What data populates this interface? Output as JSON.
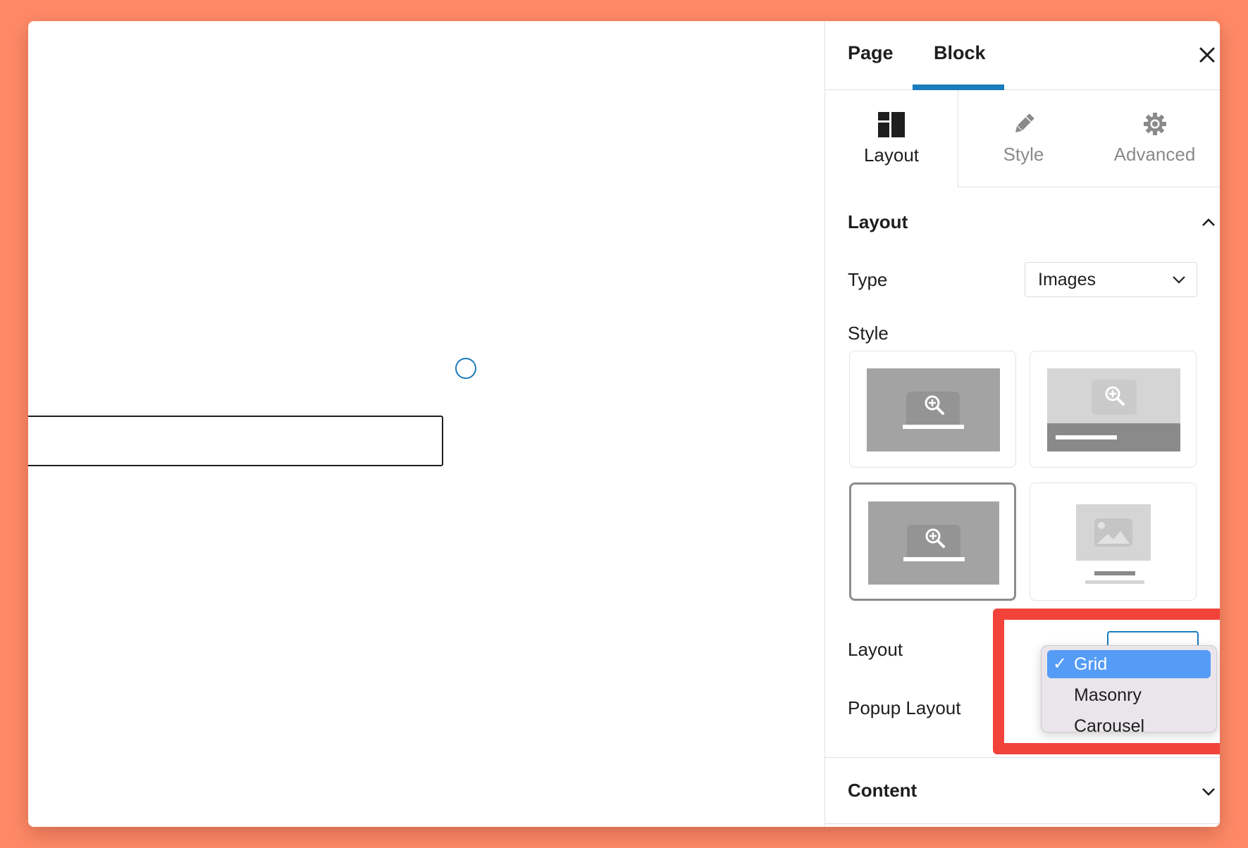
{
  "colors": {
    "background": "#FF8A68",
    "accent": "#1a7bbd",
    "highlight_box": "#f2433a",
    "selected_option": "#559cf7"
  },
  "header": {
    "tabs": [
      {
        "label": "Page",
        "active": false
      },
      {
        "label": "Block",
        "active": true
      }
    ],
    "close_icon": "close-icon"
  },
  "subtabs": [
    {
      "label": "Layout",
      "icon": "layout-icon",
      "active": true
    },
    {
      "label": "Style",
      "icon": "pencil-icon",
      "active": false
    },
    {
      "label": "Advanced",
      "icon": "gear-icon",
      "active": false
    }
  ],
  "sections": {
    "layout": {
      "title": "Layout",
      "expanded": true,
      "type_label": "Type",
      "type_value": "Images",
      "style_label": "Style",
      "style_options": [
        {
          "name": "overlay-caption",
          "selected": false
        },
        {
          "name": "caption-bar",
          "selected": false
        },
        {
          "name": "overlay-caption-alt",
          "selected": true
        },
        {
          "name": "caption-below",
          "selected": false
        }
      ],
      "layout_label": "Layout",
      "layout_options": [
        {
          "label": "Grid",
          "selected": true
        },
        {
          "label": "Masonry",
          "selected": false
        },
        {
          "label": "Carousel",
          "selected": false
        }
      ],
      "check_mark": "✓",
      "popup_layout_label": "Popup Layout"
    },
    "content": {
      "title": "Content",
      "expanded": false
    }
  }
}
